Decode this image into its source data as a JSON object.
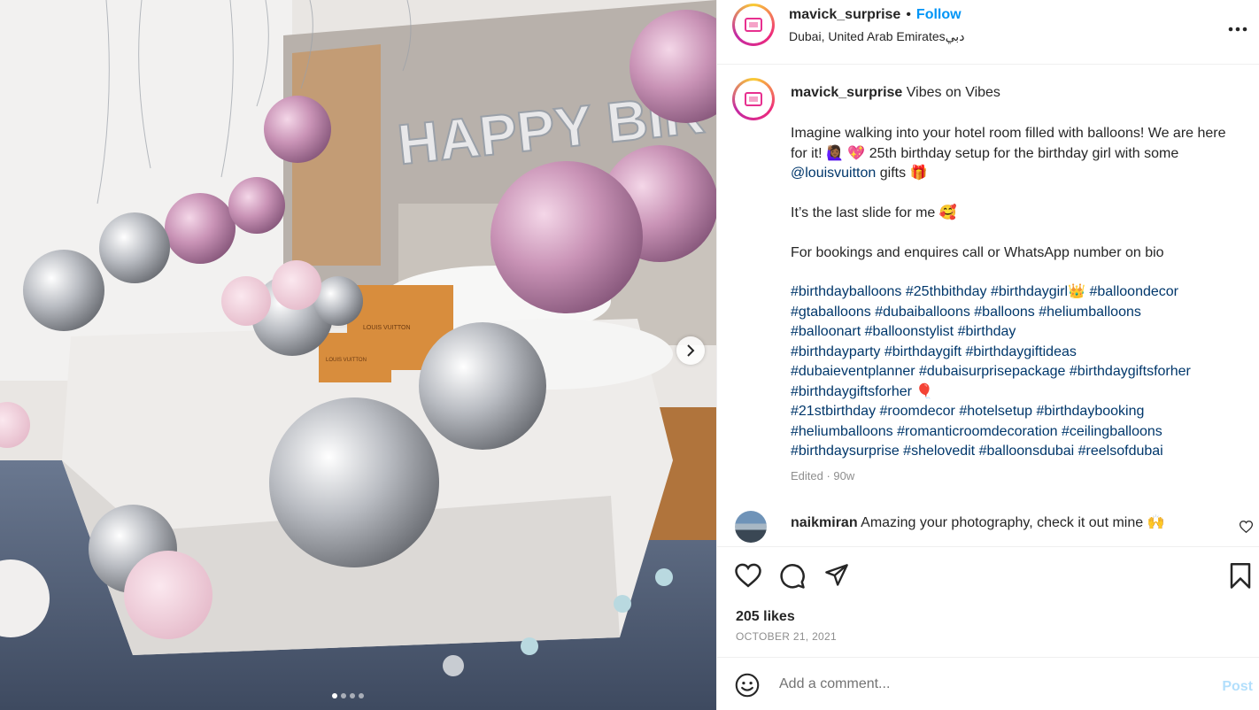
{
  "post": {
    "username": "mavick_surprise",
    "separator": "•",
    "follow_label": "Follow",
    "location": "Dubai, United Arab Emiratesدبي",
    "more_label": "···"
  },
  "media": {
    "banner_text": "HAPPY BIRTHDAY",
    "bag_label_1": "LOUIS VUITTON",
    "bag_label_2": "LOUIS VUITTON",
    "slide_count": 5,
    "active_slide": 1
  },
  "caption": {
    "username": "mavick_surprise",
    "title": "Vibes on Vibes",
    "body_part1": "Imagine walking into your hotel room filled with balloons! We are here for it! 🙋🏾‍♀️ 💖 25th birthday setup for the birthday girl with some ",
    "mention": "@louisvuitton",
    "body_part2": " gifts 🎁\n\nIt’s the last slide for me 🥰\n\nFor bookings and enquires call or WhatsApp number on bio",
    "hashtags": [
      "#birthdayballoons #25thbithday #birthdaygirl👑  #balloondecor",
      "#gtaballoons #dubaiballoons #balloons #heliumballoons",
      "#balloonart #balloonstylist #birthday",
      "#birthdayparty #birthdaygift #birthdaygiftideas",
      "#dubaieventplanner #dubaisurprisepackage #birthdaygiftsforher",
      "#birthdaygiftsforher 🎈",
      "#21stbirthday #roomdecor #hotelsetup #birthdaybooking",
      "#heliumballoons #romanticroomdecoration #ceilingballoons",
      "#birthdaysurprise #shelovedit #balloonsdubai #reelsofdubai"
    ],
    "edited": "Edited · 90w"
  },
  "comment": {
    "username": "naikmiran",
    "text": "Amazing your photography, check it out mine 🙌"
  },
  "footer": {
    "likes": "205 likes",
    "date": "OCTOBER 21, 2021",
    "comment_placeholder": "Add a comment...",
    "post_label": "Post"
  },
  "colors": {
    "link_blue": "#0095f6",
    "hashtag": "#00376b",
    "muted": "#8e8e8e",
    "post_disabled": "#b2dffc"
  },
  "icons": [
    "heart-icon",
    "comment-icon",
    "share-icon",
    "bookmark-icon",
    "emoji-icon",
    "chevron-right-icon",
    "more-icon"
  ]
}
